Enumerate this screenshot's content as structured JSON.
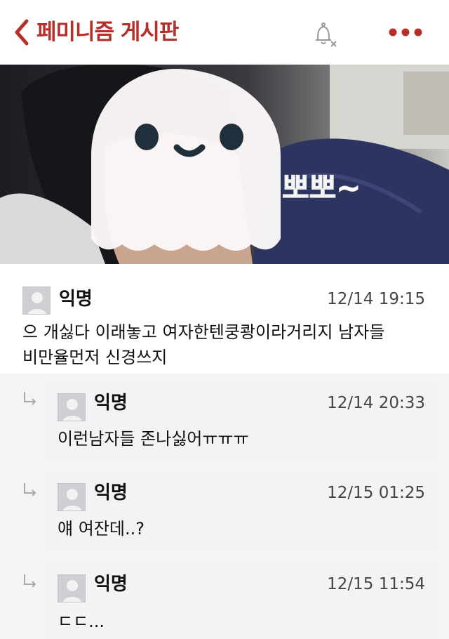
{
  "header": {
    "title": "페미니즘 게시판"
  },
  "photo": {
    "caption": "뽀뽀~"
  },
  "comments": [
    {
      "author": "익명",
      "time": "12/14 19:15",
      "text_line1": "으 개싫다 이래놓고 여자한텐쿵쾅이라거리지 남자들",
      "text_line2": "비만율먼저 신경쓰지"
    }
  ],
  "replies": [
    {
      "author": "익명",
      "time": "12/14 20:33",
      "text": "이런남자들 존나싫어ㅠㅠㅠ"
    },
    {
      "author": "익명",
      "time": "12/15 01:25",
      "text": "얘 여잔데..?"
    },
    {
      "author": "익명",
      "time": "12/15 11:54",
      "text": "ㄷㄷ..."
    }
  ],
  "colors": {
    "accent": "#b5302b",
    "reply_bg": "#f3f3f5"
  }
}
